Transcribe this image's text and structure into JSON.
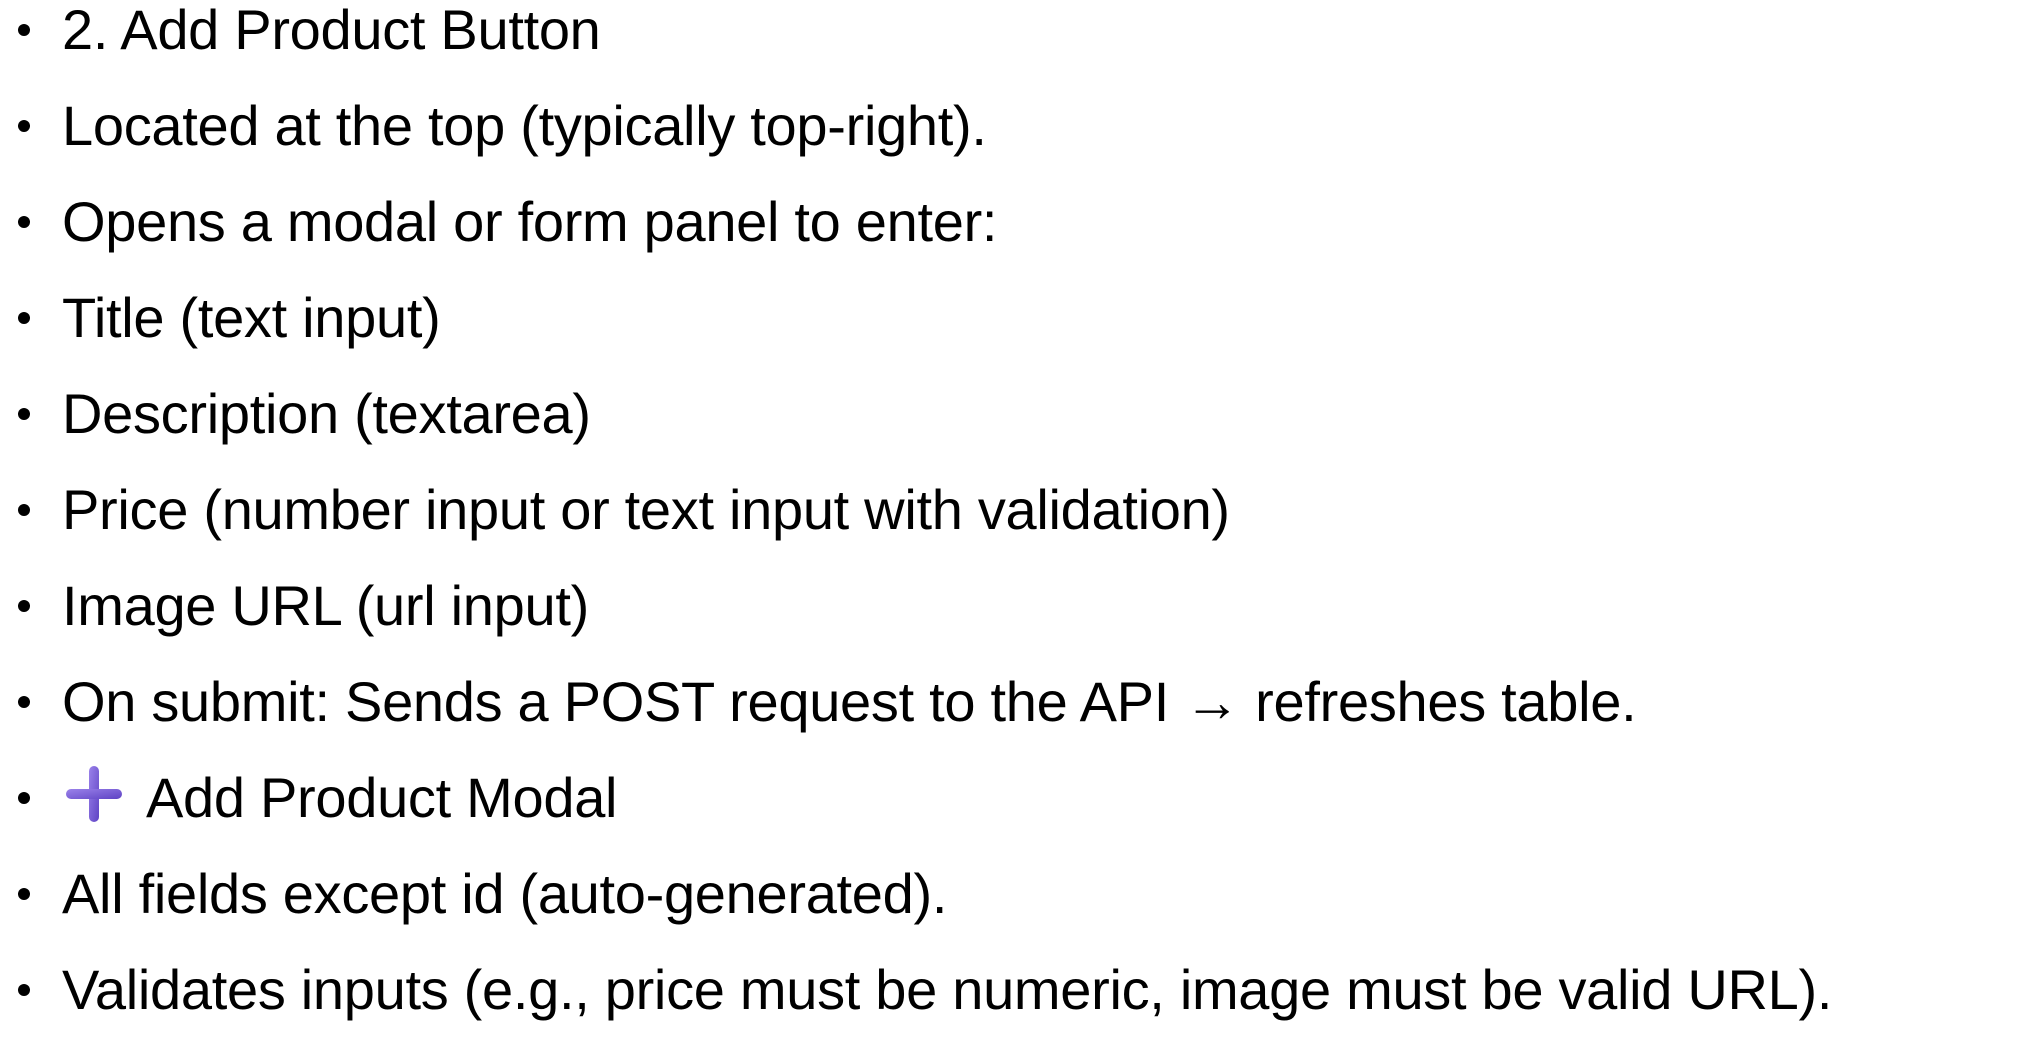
{
  "bullets": [
    {
      "text": "2. Add Product Button"
    },
    {
      "text": "Located at the top (typically top-right)."
    },
    {
      "text": "Opens a modal or form panel to enter:"
    },
    {
      "text": "Title (text input)"
    },
    {
      "text": "Description (textarea)"
    },
    {
      "text": "Price (number input or text input with validation)"
    },
    {
      "text": "Image URL (url input)"
    },
    {
      "text": "On submit: Sends a POST request to the API → refreshes table."
    },
    {
      "text": "Add Product Modal",
      "icon": "plus-icon",
      "icon_color": "#7b5fd6"
    },
    {
      "text": "All fields except id (auto-generated)."
    },
    {
      "text": "Validates inputs (e.g., price must be numeric, image must be valid URL)."
    }
  ]
}
